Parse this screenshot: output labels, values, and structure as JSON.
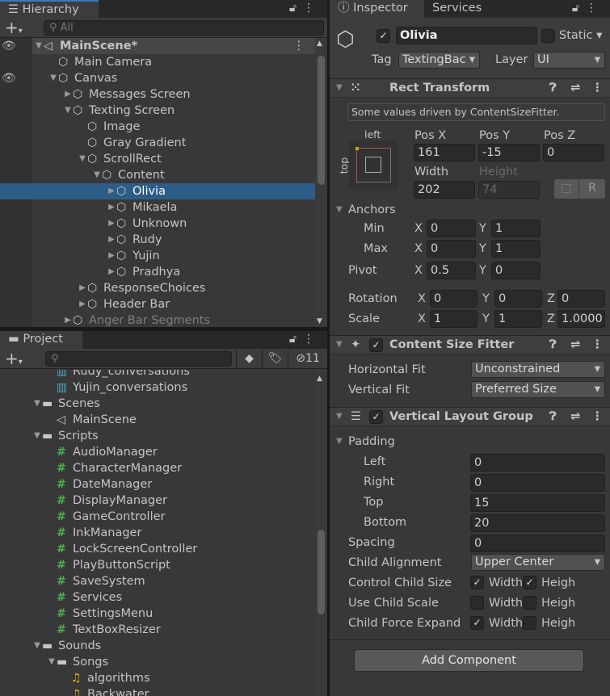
{
  "hierarchy": {
    "tab": "Hierarchy",
    "search_placeholder": "All",
    "rows": [
      {
        "label": "MainScene*",
        "depth": 0,
        "arrow": "open",
        "icon": "unity-scene",
        "bold": true,
        "header": true
      },
      {
        "label": "Main Camera",
        "depth": 1,
        "arrow": "none",
        "icon": "gameobject"
      },
      {
        "label": "Canvas",
        "depth": 1,
        "arrow": "open",
        "icon": "gameobject"
      },
      {
        "label": "Messages Screen",
        "depth": 2,
        "arrow": "closed",
        "icon": "gameobject"
      },
      {
        "label": "Texting Screen",
        "depth": 2,
        "arrow": "open",
        "icon": "gameobject"
      },
      {
        "label": "Image",
        "depth": 3,
        "arrow": "none",
        "icon": "gameobject"
      },
      {
        "label": "Gray Gradient",
        "depth": 3,
        "arrow": "none",
        "icon": "gameobject"
      },
      {
        "label": "ScrollRect",
        "depth": 3,
        "arrow": "open",
        "icon": "gameobject"
      },
      {
        "label": "Content",
        "depth": 4,
        "arrow": "open",
        "icon": "gameobject"
      },
      {
        "label": "Olivia",
        "depth": 5,
        "arrow": "closed",
        "icon": "gameobject",
        "selected": true
      },
      {
        "label": "Mikaela",
        "depth": 5,
        "arrow": "closed",
        "icon": "gameobject"
      },
      {
        "label": "Unknown",
        "depth": 5,
        "arrow": "closed",
        "icon": "gameobject"
      },
      {
        "label": "Rudy",
        "depth": 5,
        "arrow": "closed",
        "icon": "gameobject"
      },
      {
        "label": "Yujin",
        "depth": 5,
        "arrow": "closed",
        "icon": "gameobject"
      },
      {
        "label": "Pradhya",
        "depth": 5,
        "arrow": "closed",
        "icon": "gameobject"
      },
      {
        "label": "ResponseChoices",
        "depth": 3,
        "arrow": "closed",
        "icon": "gameobject"
      },
      {
        "label": "Header Bar",
        "depth": 3,
        "arrow": "closed",
        "icon": "gameobject"
      },
      {
        "label": "Anger Bar Segments",
        "depth": 2,
        "arrow": "closed",
        "icon": "gameobject",
        "dim": true
      }
    ]
  },
  "project": {
    "tab": "Project",
    "hidden_count": "11",
    "rows": [
      {
        "label": "Rudy_conversations",
        "depth": 2,
        "arrow": "none",
        "icon": "ink-file"
      },
      {
        "label": "Yujin_conversations",
        "depth": 2,
        "arrow": "none",
        "icon": "ink-file"
      },
      {
        "label": "Scenes",
        "depth": 1,
        "arrow": "open",
        "icon": "folder"
      },
      {
        "label": "MainScene",
        "depth": 2,
        "arrow": "none",
        "icon": "unity-scene"
      },
      {
        "label": "Scripts",
        "depth": 1,
        "arrow": "open",
        "icon": "folder"
      },
      {
        "label": "AudioManager",
        "depth": 2,
        "arrow": "none",
        "icon": "script"
      },
      {
        "label": "CharacterManager",
        "depth": 2,
        "arrow": "none",
        "icon": "script"
      },
      {
        "label": "DateManager",
        "depth": 2,
        "arrow": "none",
        "icon": "script"
      },
      {
        "label": "DisplayManager",
        "depth": 2,
        "arrow": "none",
        "icon": "script"
      },
      {
        "label": "GameController",
        "depth": 2,
        "arrow": "none",
        "icon": "script"
      },
      {
        "label": "InkManager",
        "depth": 2,
        "arrow": "none",
        "icon": "script"
      },
      {
        "label": "LockScreenController",
        "depth": 2,
        "arrow": "none",
        "icon": "script"
      },
      {
        "label": "PlayButtonScript",
        "depth": 2,
        "arrow": "none",
        "icon": "script"
      },
      {
        "label": "SaveSystem",
        "depth": 2,
        "arrow": "none",
        "icon": "script"
      },
      {
        "label": "Services",
        "depth": 2,
        "arrow": "none",
        "icon": "script"
      },
      {
        "label": "SettingsMenu",
        "depth": 2,
        "arrow": "none",
        "icon": "script"
      },
      {
        "label": "TextBoxResizer",
        "depth": 2,
        "arrow": "none",
        "icon": "script"
      },
      {
        "label": "Sounds",
        "depth": 1,
        "arrow": "open",
        "icon": "folder"
      },
      {
        "label": "Songs",
        "depth": 2,
        "arrow": "open",
        "icon": "folder"
      },
      {
        "label": "algorithms",
        "depth": 3,
        "arrow": "none",
        "icon": "audio"
      },
      {
        "label": "Backwater",
        "depth": 3,
        "arrow": "none",
        "icon": "audio"
      }
    ]
  },
  "inspector": {
    "tabs": [
      "Inspector",
      "Services"
    ],
    "name": "Olivia",
    "active": true,
    "static_label": "Static",
    "static": false,
    "tag_label": "Tag",
    "tag": "TextingBac",
    "layer_label": "Layer",
    "layer": "UI",
    "rect": {
      "title": "Rect Transform",
      "notice": "Some values driven by ContentSizeFitter.",
      "anchor_h": "left",
      "anchor_v": "top",
      "posx_label": "Pos X",
      "posy_label": "Pos Y",
      "posz_label": "Pos Z",
      "posx": "161",
      "posy": "-15",
      "posz": "0",
      "width_label": "Width",
      "height_label": "Height",
      "width": "202",
      "height": "74",
      "raw_btn": "R",
      "anchors_label": "Anchors",
      "min_label": "Min",
      "max_label": "Max",
      "pivot_label": "Pivot",
      "min_x": "0",
      "min_y": "1",
      "max_x": "0",
      "max_y": "1",
      "pivot_x": "0.5",
      "pivot_y": "0",
      "rotation_label": "Rotation",
      "scale_label": "Scale",
      "rot": [
        "0",
        "0",
        "0"
      ],
      "scale": [
        "1",
        "1",
        "1.0000"
      ],
      "x": "X",
      "y": "Y",
      "z": "Z"
    },
    "csf": {
      "title": "Content Size Fitter",
      "enabled": true,
      "hfit_label": "Horizontal Fit",
      "hfit": "Unconstrained",
      "vfit_label": "Vertical Fit",
      "vfit": "Preferred Size"
    },
    "vlg": {
      "title": "Vertical Layout Group",
      "enabled": true,
      "padding_label": "Padding",
      "left_label": "Left",
      "right_label": "Right",
      "top_label": "Top",
      "bottom_label": "Bottom",
      "left": "0",
      "right": "0",
      "top": "15",
      "bottom": "20",
      "spacing_label": "Spacing",
      "spacing": "0",
      "align_label": "Child Alignment",
      "align": "Upper Center",
      "ccs_label": "Control Child Size",
      "ucs_label": "Use Child Scale",
      "cfe_label": "Child Force Expand",
      "width_word": "Width",
      "height_word": "Heigh",
      "ccs": [
        true,
        true
      ],
      "ucs": [
        false,
        false
      ],
      "cfe": [
        true,
        false
      ]
    },
    "add_component": "Add Component"
  },
  "colors": {
    "selection": "#2c5d87",
    "panel": "#383838",
    "tabbar": "#282828"
  }
}
